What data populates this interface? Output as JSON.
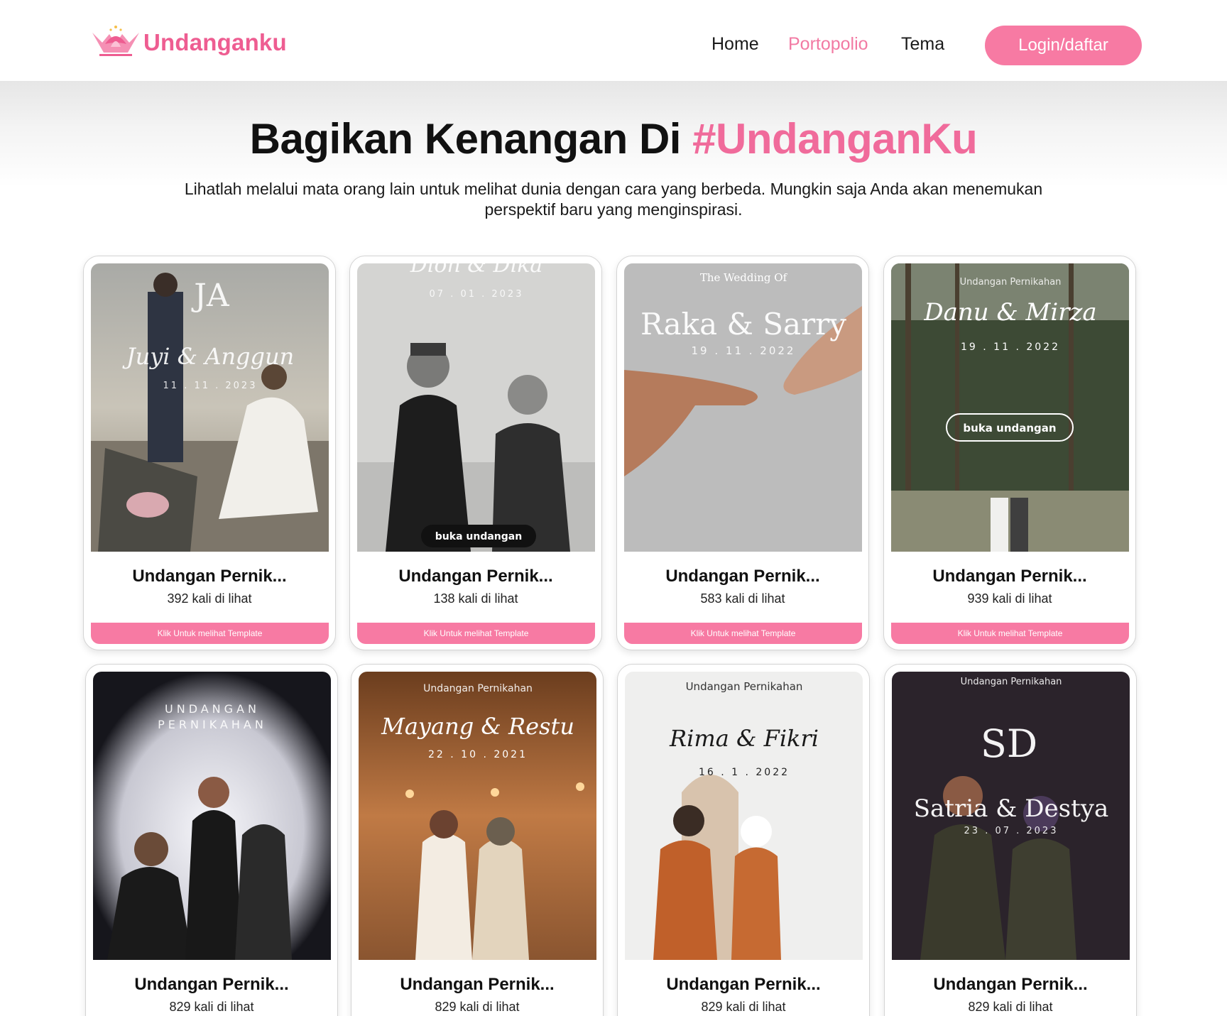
{
  "brand": {
    "name": "Undanganku",
    "primary_color": "#f77aa3",
    "accent_color": "#f06b9b"
  },
  "nav": {
    "items": [
      {
        "label": "Home",
        "active": false
      },
      {
        "label": "Portopolio",
        "active": true
      },
      {
        "label": "Tema",
        "active": false
      }
    ],
    "login_label": "Login/daftar"
  },
  "hero": {
    "title_main": "Bagikan Kenangan Di ",
    "title_accent": "#UndanganKu",
    "subtitle": "Lihatlah melalui mata orang lain untuk melihat dunia dengan cara yang berbeda. Mungkin saja Anda akan menemukan perspektif baru yang menginspirasi."
  },
  "cards": [
    {
      "title": "Undangan Pernik...",
      "views": "392 kali di lihat",
      "button": "Klik Untuk melihat Template",
      "overlay": {
        "monogram": "JA",
        "names": "Juyi & Anggun",
        "date": "11 . 11 . 2023"
      }
    },
    {
      "title": "Undangan Pernik...",
      "views": "138 kali di lihat",
      "button": "Klik Untuk melihat Template",
      "overlay": {
        "names": "Dion & Dika",
        "date": "07 . 01 . 2023",
        "open_button": "buka undangan"
      }
    },
    {
      "title": "Undangan Pernik...",
      "views": "583 kali di lihat",
      "button": "Klik Untuk melihat Template",
      "overlay": {
        "heading": "The Wedding Of",
        "names": "Raka & Sarry",
        "date": "19 . 11 . 2022"
      }
    },
    {
      "title": "Undangan Pernik...",
      "views": "939 kali di lihat",
      "button": "Klik Untuk melihat Template",
      "overlay": {
        "heading": "Undangan Pernikahan",
        "names": "Danu & Mirza",
        "date": "19 . 11 . 2022",
        "open_button": "buka undangan"
      }
    },
    {
      "title": "Undangan Pernik...",
      "views": "829 kali di lihat",
      "overlay": {
        "heading": "UNDANGAN",
        "heading2": "PERNIKAHAN"
      }
    },
    {
      "title": "Undangan Pernik...",
      "views": "829 kali di lihat",
      "overlay": {
        "heading": "Undangan Pernikahan",
        "names": "Mayang & Restu",
        "date": "22 . 10 . 2021"
      }
    },
    {
      "title": "Undangan Pernik...",
      "views": "829 kali di lihat",
      "overlay": {
        "heading": "Undangan Pernikahan",
        "names": "Rima & Fikri",
        "date": "16 . 1 . 2022"
      }
    },
    {
      "title": "Undangan Pernik...",
      "views": "829 kali di lihat",
      "overlay": {
        "heading": "Undangan Pernikahan",
        "monogram": "SD",
        "names": "Satria & Destya",
        "date": "23 . 07 . 2023"
      }
    }
  ]
}
